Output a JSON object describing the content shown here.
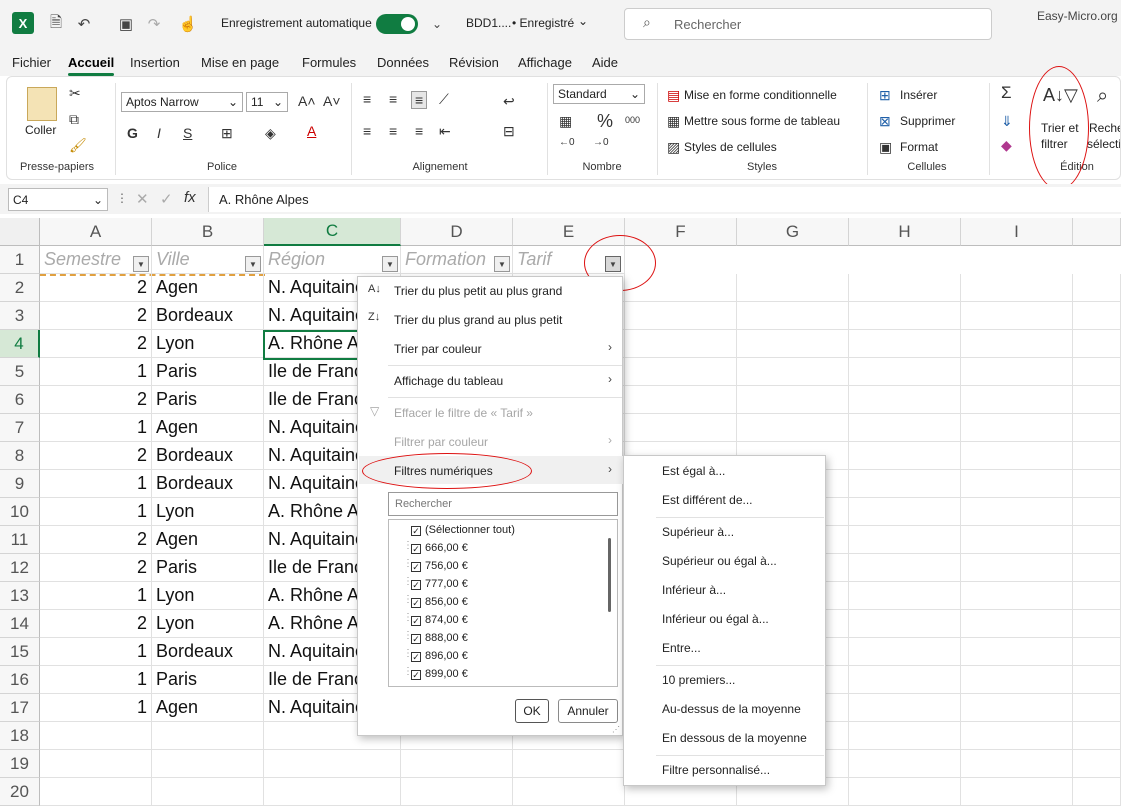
{
  "titlebar": {
    "autosave_label": "Enregistrement automatique",
    "filename": "BDD1....",
    "saved_status": "• Enregistré",
    "search_placeholder": "Rechercher",
    "site_label": "Easy-Micro.org"
  },
  "menu_tabs": [
    "Fichier",
    "Accueil",
    "Insertion",
    "Mise en page",
    "Formules",
    "Données",
    "Révision",
    "Affichage",
    "Aide"
  ],
  "ribbon": {
    "clipboard": {
      "paste_label": "Coller",
      "group_label": "Presse-papiers"
    },
    "font": {
      "font_name": "Aptos Narrow",
      "font_size": "11",
      "bold": "G",
      "italic": "I",
      "underline": "S",
      "group_label": "Police"
    },
    "alignment": {
      "group_label": "Alignement"
    },
    "number": {
      "format": "Standard",
      "group_label": "Nombre"
    },
    "styles": {
      "conditional": "Mise en forme conditionnelle",
      "table": "Mettre sous forme de tableau",
      "cell_styles": "Styles de cellules",
      "group_label": "Styles"
    },
    "cells": {
      "insert": "Insérer",
      "delete": "Supprimer",
      "format": "Format",
      "group_label": "Cellules"
    },
    "editing": {
      "sort_filter_l1": "Trier et",
      "sort_filter_l2": "filtrer",
      "find_l1": "Recher",
      "find_l2": "sélectio",
      "group_label": "Édition"
    }
  },
  "formula_bar": {
    "name_box": "C4",
    "fx": "fx",
    "content": "A. Rhône Alpes"
  },
  "columns": [
    "A",
    "B",
    "C",
    "D",
    "E",
    "F",
    "G",
    "H",
    "I"
  ],
  "header_row": {
    "semestre": "Semestre",
    "ville": "Ville",
    "region": "Région",
    "formation": "Formation",
    "tarif": "Tarif"
  },
  "rows": [
    {
      "n": "2",
      "sem": "2",
      "ville": "Agen",
      "region": "N. Aquitaine"
    },
    {
      "n": "3",
      "sem": "2",
      "ville": "Bordeaux",
      "region": "N. Aquitaine"
    },
    {
      "n": "4",
      "sem": "2",
      "ville": "Lyon",
      "region": "A. Rhône Alpes"
    },
    {
      "n": "5",
      "sem": "1",
      "ville": "Paris",
      "region": "Ile de France"
    },
    {
      "n": "6",
      "sem": "2",
      "ville": "Paris",
      "region": "Ile de France"
    },
    {
      "n": "7",
      "sem": "1",
      "ville": "Agen",
      "region": "N. Aquitaine"
    },
    {
      "n": "8",
      "sem": "2",
      "ville": "Bordeaux",
      "region": "N. Aquitaine"
    },
    {
      "n": "9",
      "sem": "1",
      "ville": "Bordeaux",
      "region": "N. Aquitaine"
    },
    {
      "n": "10",
      "sem": "1",
      "ville": "Lyon",
      "region": "A. Rhône Alpes"
    },
    {
      "n": "11",
      "sem": "2",
      "ville": "Agen",
      "region": "N. Aquitaine"
    },
    {
      "n": "12",
      "sem": "2",
      "ville": "Paris",
      "region": "Ile de France"
    },
    {
      "n": "13",
      "sem": "1",
      "ville": "Lyon",
      "region": "A. Rhône Alpes"
    },
    {
      "n": "14",
      "sem": "2",
      "ville": "Lyon",
      "region": "A. Rhône Alpes"
    },
    {
      "n": "15",
      "sem": "1",
      "ville": "Bordeaux",
      "region": "N. Aquitaine"
    },
    {
      "n": "16",
      "sem": "1",
      "ville": "Paris",
      "region": "Ile de France"
    },
    {
      "n": "17",
      "sem": "1",
      "ville": "Agen",
      "region": "N. Aquitaine"
    },
    {
      "n": "18",
      "sem": "",
      "ville": "",
      "region": ""
    },
    {
      "n": "19",
      "sem": "",
      "ville": "",
      "region": ""
    },
    {
      "n": "20",
      "sem": "",
      "ville": "",
      "region": ""
    }
  ],
  "filter_menu": {
    "sort_asc": "Trier du plus petit au plus grand",
    "sort_desc": "Trier du plus grand au plus petit",
    "sort_color": "Trier par couleur",
    "table_view": "Affichage du tableau",
    "clear_filter": "Effacer le filtre de « Tarif »",
    "filter_color": "Filtrer par couleur",
    "number_filters": "Filtres numériques",
    "search_placeholder": "Rechercher",
    "values": [
      "(Sélectionner tout)",
      "666,00 €",
      "756,00 €",
      "777,00 €",
      "856,00 €",
      "874,00 €",
      "888,00 €",
      "896,00 €",
      "899,00 €"
    ],
    "ok": "OK",
    "cancel": "Annuler"
  },
  "submenu": [
    "Est égal à...",
    "Est différent de...",
    "Supérieur à...",
    "Supérieur ou égal à...",
    "Inférieur à...",
    "Inférieur ou égal à...",
    "Entre...",
    "10 premiers...",
    "Au-dessus de la moyenne",
    "En dessous de la moyenne",
    "Filtre personnalisé..."
  ],
  "colors": {
    "accent": "#107c41",
    "highlight": "#d11111"
  }
}
